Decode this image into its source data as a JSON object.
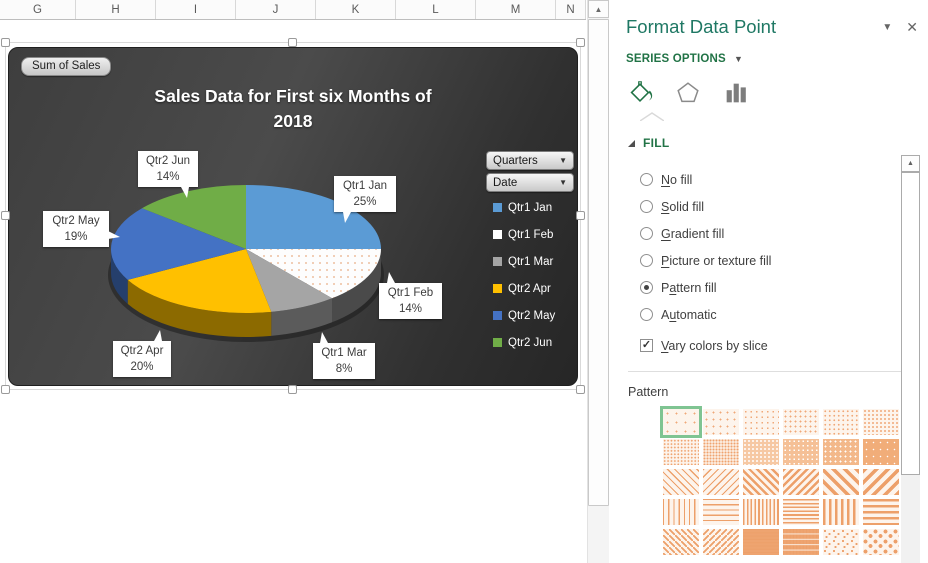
{
  "spreadsheet": {
    "column_headers": [
      "G",
      "H",
      "I",
      "J",
      "K",
      "L",
      "M",
      "N"
    ]
  },
  "chart": {
    "field_button": "Sum of Sales",
    "title_lines": [
      "Sales Data for First six Months of",
      "2018"
    ],
    "filter_buttons": [
      "Quarters",
      "Date"
    ],
    "callouts": [
      {
        "name": "Qtr2 Jun",
        "pct": "14%"
      },
      {
        "name": "Qtr1 Jan",
        "pct": "25%"
      },
      {
        "name": "Qtr2 May",
        "pct": "19%"
      },
      {
        "name": "Qtr1 Feb",
        "pct": "14%"
      },
      {
        "name": "Qtr2 Apr",
        "pct": "20%"
      },
      {
        "name": "Qtr1 Mar",
        "pct": "8%"
      }
    ]
  },
  "chart_data": {
    "type": "pie",
    "title": "Sales Data for First six Months of 2018",
    "categories": [
      "Qtr1 Jan",
      "Qtr1 Feb",
      "Qtr1 Mar",
      "Qtr2 Apr",
      "Qtr2 May",
      "Qtr2 Jun"
    ],
    "values": [
      25,
      14,
      8,
      20,
      19,
      14
    ],
    "unit": "percent",
    "colors": [
      "#5B9BD5",
      "#FFFFFF",
      "#A5A5A5",
      "#FFC000",
      "#4472C4",
      "#70AD47"
    ],
    "is_3d": true,
    "legend_position": "right",
    "selected_point": "Qtr1 Feb",
    "selected_point_fill": "5% dot pattern, orange on white"
  },
  "panel": {
    "title": "Format Data Point",
    "series_options_label": "SERIES OPTIONS",
    "tabs": [
      {
        "name": "fill-line",
        "selected": true
      },
      {
        "name": "effects",
        "selected": false
      },
      {
        "name": "series-options",
        "selected": false
      }
    ],
    "fill": {
      "section_label": "FILL",
      "options": [
        {
          "label": "No fill",
          "underline": 0,
          "selected": false
        },
        {
          "label": "Solid fill",
          "underline": 0,
          "selected": false
        },
        {
          "label": "Gradient fill",
          "underline": 0,
          "selected": false
        },
        {
          "label": "Picture or texture fill",
          "underline": 0,
          "selected": false
        },
        {
          "label": "Pattern fill",
          "underline": 1,
          "selected": true
        },
        {
          "label": "Automatic",
          "underline": 1,
          "selected": false
        }
      ],
      "vary_colors_checkbox": {
        "label": "Vary colors by slice",
        "underline": 0,
        "checked": true
      },
      "pattern_label": "Pattern",
      "patterns": [
        "5%",
        "10%",
        "20%",
        "25%",
        "30%",
        "40%",
        "50%",
        "60%",
        "70%",
        "75%",
        "80%",
        "90%",
        "Light downward diagonal",
        "Light upward diagonal",
        "Dark downward diagonal",
        "Dark upward diagonal",
        "Wide downward diagonal",
        "Wide upward diagonal",
        "Light vertical",
        "Light horizontal",
        "Narrow vertical",
        "Narrow horizontal",
        "Dark vertical",
        "Dark horizontal",
        "Dashed downward diagonal",
        "Dashed upward diagonal",
        "Dashed horizontal",
        "Dashed vertical",
        "Small confetti",
        "Large confetti"
      ],
      "selected_pattern": "5%"
    }
  },
  "colors": {
    "accent_green": "#217346",
    "pane_title_green": "#1F7864",
    "pattern_foreground": "#EDA06A",
    "selected_swatch_border": "#7FC492"
  }
}
